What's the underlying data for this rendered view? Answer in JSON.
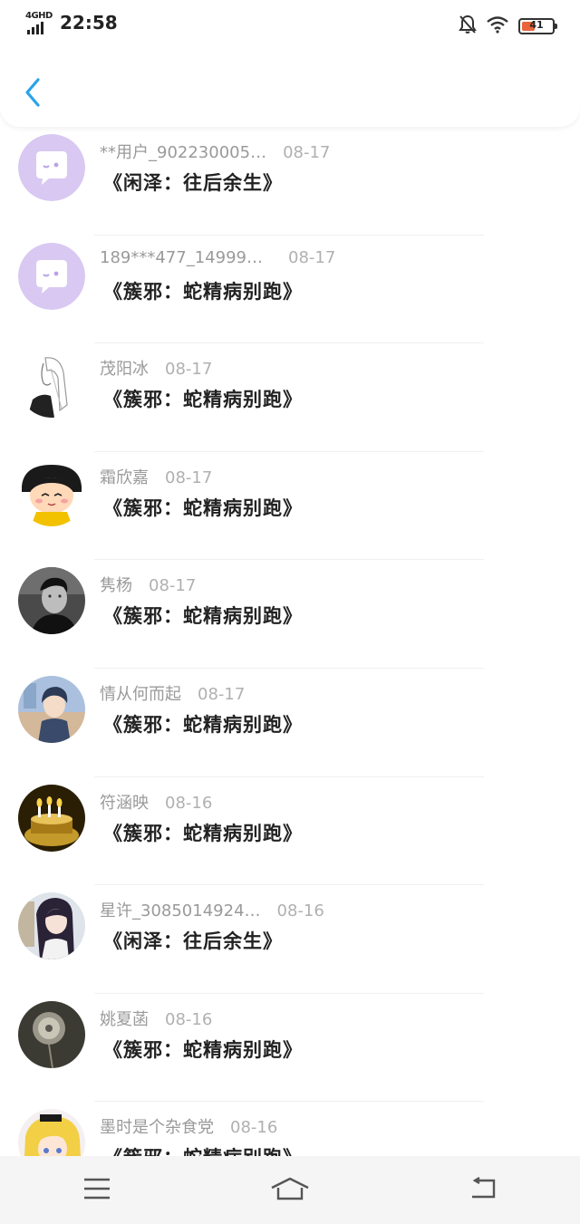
{
  "status_bar": {
    "network": "4GHD",
    "time": "22:58",
    "battery": "41",
    "battery_level_percent": 41
  },
  "header": {
    "back_icon": "chevron-left-icon",
    "accent_color": "#2aa3e8"
  },
  "items": [
    {
      "name": "**用户_902230005…",
      "date": "08-17",
      "title": "《闲泽：往后余生》",
      "avatar": "default-chat"
    },
    {
      "name": "189***477_149998…",
      "date": "08-17",
      "title": "《簇邪：蛇精病别跑》",
      "avatar": "default-chat"
    },
    {
      "name": "茂阳冰",
      "date": "08-17",
      "title": "《簇邪：蛇精病别跑》",
      "avatar": "sketch-girl"
    },
    {
      "name": "霜欣嘉",
      "date": "08-17",
      "title": "《簇邪：蛇精病别跑》",
      "avatar": "cartoon-girl"
    },
    {
      "name": "隽杨",
      "date": "08-17",
      "title": "《簇邪：蛇精病别跑》",
      "avatar": "bw-man"
    },
    {
      "name": "情从何而起",
      "date": "08-17",
      "title": "《簇邪：蛇精病别跑》",
      "avatar": "anime-boy"
    },
    {
      "name": "符涵映",
      "date": "08-16",
      "title": "《簇邪：蛇精病别跑》",
      "avatar": "candles"
    },
    {
      "name": "星许_3085014924…",
      "date": "08-16",
      "title": "《闲泽：往后余生》",
      "avatar": "anime-girl"
    },
    {
      "name": "姚夏菡",
      "date": "08-16",
      "title": "《簇邪：蛇精病别跑》",
      "avatar": "dandelion"
    },
    {
      "name": "墨时是个杂食党",
      "date": "08-16",
      "title": "《簇邪：蛇精病别跑》",
      "avatar": "blonde-anime"
    }
  ],
  "nav_bar": {
    "menu_icon": "menu-icon",
    "home_icon": "home-icon",
    "back_icon": "back-arrow-icon"
  }
}
